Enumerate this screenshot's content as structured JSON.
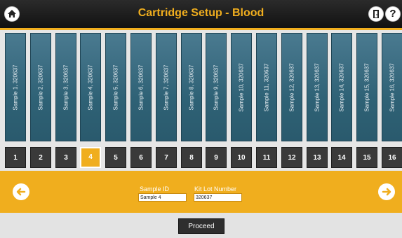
{
  "header": {
    "title": "Cartridge Setup - Blood",
    "help_label": "?"
  },
  "cartridges": [
    {
      "label": "Sample 1, 320637",
      "number": "1"
    },
    {
      "label": "Sample 2, 320637",
      "number": "2"
    },
    {
      "label": "Sample 3, 320637",
      "number": "3"
    },
    {
      "label": "Sample 4, 320637",
      "number": "4"
    },
    {
      "label": "Sample 5, 320637",
      "number": "5"
    },
    {
      "label": "Sample 6, 320637",
      "number": "6"
    },
    {
      "label": "Sample 7, 320637",
      "number": "7"
    },
    {
      "label": "Sample 8, 320637",
      "number": "8"
    },
    {
      "label": "Sample 9, 320637",
      "number": "9"
    },
    {
      "label": "Sample 10, 320637",
      "number": "10"
    },
    {
      "label": "Sample 11, 320637",
      "number": "11"
    },
    {
      "label": "Sample 12, 320637",
      "number": "12"
    },
    {
      "label": "Sample 13, 320637",
      "number": "13"
    },
    {
      "label": "Sample 14, 320637",
      "number": "14"
    },
    {
      "label": "Sample 15, 320637",
      "number": "15"
    },
    {
      "label": "Sample 16, 320637",
      "number": "16"
    }
  ],
  "selected_index": 3,
  "form": {
    "sample_id_label": "Sample ID",
    "sample_id_value": "Sample 4",
    "kit_lot_label": "Kit Lot Number",
    "kit_lot_value": "320637"
  },
  "proceed_label": "Proceed",
  "colors": {
    "accent": "#f0ae1e",
    "cartridge": "#2f6276",
    "titlebar": "#111111"
  },
  "icons": {
    "home": "home-icon",
    "door": "door-exit-icon",
    "help": "help-icon",
    "prev": "arrow-left-icon",
    "next": "arrow-right-icon"
  }
}
